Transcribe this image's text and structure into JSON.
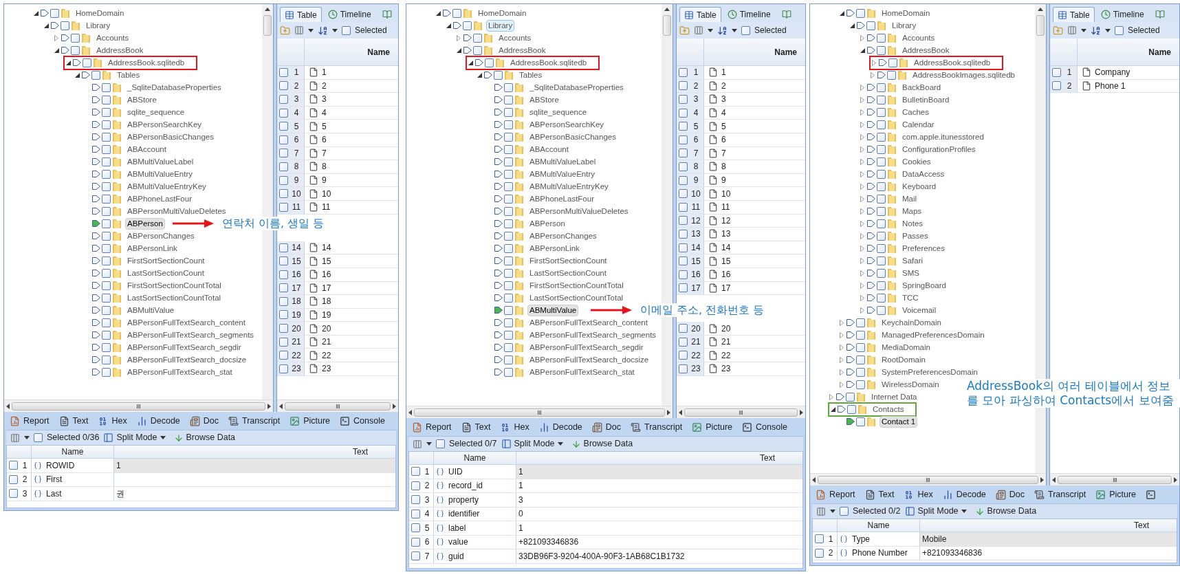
{
  "panels": [
    {
      "tree": {
        "inner": [
          {
            "label": "HomeDomain",
            "expanded": true,
            "selected": false,
            "checked": false,
            "children": [
              {
                "label": "Library",
                "expanded": true,
                "selected": false,
                "checked": false,
                "children": [
                  {
                    "label": "Accounts",
                    "expanded": false,
                    "selected": false,
                    "checked": false
                  },
                  {
                    "label": "AddressBook",
                    "expanded": true,
                    "selected": false,
                    "checked": false,
                    "children": [
                      {
                        "label": "AddressBook.sqlitedb",
                        "expanded": true,
                        "selected": false,
                        "checked": false,
                        "color": "#e8141b",
                        "children": [
                          {
                            "label": "Tables",
                            "expanded": true,
                            "selected": false,
                            "checked": false,
                            "children": [
                              {
                                "label": "_SqliteDatabaseProperties",
                                "selected": false,
                                "checked": false
                              },
                              {
                                "label": "ABStore",
                                "selected": false,
                                "checked": false
                              },
                              {
                                "label": "sqlite_sequence",
                                "selected": false,
                                "checked": false
                              },
                              {
                                "label": "ABPersonSearchKey",
                                "selected": false,
                                "checked": false
                              },
                              {
                                "label": "ABPersonBasicChanges",
                                "selected": false,
                                "checked": false
                              },
                              {
                                "label": "ABAccount",
                                "selected": false,
                                "checked": false
                              },
                              {
                                "label": "ABMultiValueLabel",
                                "selected": false,
                                "checked": false
                              },
                              {
                                "label": "ABMultiValueEntry",
                                "selected": false,
                                "checked": false
                              },
                              {
                                "label": "ABMultiValueEntryKey",
                                "selected": false,
                                "checked": false
                              },
                              {
                                "label": "ABPhoneLastFour",
                                "selected": false,
                                "checked": false
                              },
                              {
                                "label": "ABPersonMultiValueDeletes",
                                "selected": false,
                                "checked": false
                              },
                              {
                                "label": "ABPerson",
                                "selected": true,
                                "checked": false
                              },
                              {
                                "label": "ABPersonChanges",
                                "selected": false,
                                "checked": false
                              },
                              {
                                "label": "ABPersonLink",
                                "selected": false,
                                "checked": false
                              },
                              {
                                "label": "FirstSortSectionCount",
                                "selected": false,
                                "checked": false
                              },
                              {
                                "label": "LastSortSectionCount",
                                "selected": false,
                                "checked": false
                              },
                              {
                                "label": "FirstSortSectionCountTotal",
                                "selected": false,
                                "checked": false
                              },
                              {
                                "label": "LastSortSectionCountTotal",
                                "selected": false,
                                "checked": false
                              },
                              {
                                "label": "ABMultiValue",
                                "selected": false,
                                "checked": false
                              },
                              {
                                "label": "ABPersonFullTextSearch_content",
                                "selected": false,
                                "checked": false
                              },
                              {
                                "label": "ABPersonFullTextSearch_segments",
                                "selected": false,
                                "checked": false
                              },
                              {
                                "label": "ABPersonFullTextSearch_segdir",
                                "selected": false,
                                "checked": false
                              },
                              {
                                "label": "ABPersonFullTextSearch_docsize",
                                "selected": false,
                                "checked": false
                              },
                              {
                                "label": "ABPersonFullTextSearch_stat",
                                "selected": false,
                                "checked": false
                              }
                            ]
                          }
                        ]
                      }
                    ]
                  }
                ]
              }
            ]
          }
        ]
      },
      "callout": {
        "text": "연락처 이름, 생일 등",
        "arrow": true
      },
      "table_pane": {
        "tabs": [
          {
            "kind": "table",
            "label": "Table",
            "selected": true
          },
          {
            "kind": "timeline",
            "label": "Timeline",
            "selected": false
          },
          {
            "kind": "book",
            "selected": false
          }
        ],
        "selected_label": "Selected",
        "checked": false,
        "columns": [
          "Name"
        ],
        "rows": [
          {
            "kind": "row",
            "index": "1",
            "name": "1",
            "checked": false
          },
          {
            "kind": "row",
            "index": "2",
            "name": "2",
            "checked": false
          },
          {
            "kind": "row",
            "index": "3",
            "name": "3",
            "checked": false
          },
          {
            "kind": "row",
            "index": "4",
            "name": "4",
            "checked": false
          },
          {
            "kind": "row",
            "index": "5",
            "name": "5",
            "checked": false
          },
          {
            "kind": "row",
            "index": "6",
            "name": "6",
            "checked": false
          },
          {
            "kind": "row",
            "index": "7",
            "name": "7",
            "checked": false
          },
          {
            "kind": "row",
            "index": "8",
            "name": "8",
            "checked": false
          },
          {
            "kind": "row",
            "index": "9",
            "name": "9",
            "checked": false
          },
          {
            "kind": "row",
            "index": "10",
            "name": "10",
            "checked": false
          },
          {
            "kind": "row",
            "index": "11",
            "name": "11",
            "checked": false
          },
          {
            "kind": "covered"
          },
          {
            "kind": "covered"
          },
          {
            "kind": "row",
            "index": "14",
            "name": "14",
            "checked": false
          },
          {
            "kind": "row",
            "index": "15",
            "name": "15",
            "checked": false
          },
          {
            "kind": "row",
            "index": "16",
            "name": "16",
            "checked": false
          },
          {
            "kind": "row",
            "index": "17",
            "name": "17",
            "checked": false
          },
          {
            "kind": "row",
            "index": "18",
            "name": "18",
            "checked": false
          },
          {
            "kind": "row",
            "index": "19",
            "name": "19",
            "checked": false
          },
          {
            "kind": "row",
            "index": "20",
            "name": "20",
            "checked": false
          },
          {
            "kind": "row",
            "index": "21",
            "name": "21",
            "checked": false
          },
          {
            "kind": "row",
            "index": "22",
            "name": "22",
            "checked": false
          },
          {
            "kind": "row",
            "index": "23",
            "name": "23",
            "checked": false
          }
        ]
      },
      "view_tabs": [
        {
          "kind": "report",
          "label": "Report"
        },
        {
          "kind": "text",
          "label": "Text"
        },
        {
          "kind": "hex",
          "label": "Hex"
        },
        {
          "kind": "decode",
          "label": "Decode"
        },
        {
          "kind": "doc",
          "label": "Doc"
        },
        {
          "kind": "transcript",
          "label": "Transcript"
        },
        {
          "kind": "picture",
          "label": "Picture"
        },
        {
          "kind": "console",
          "label": "Console"
        }
      ],
      "toolbar": {
        "selected_label": "Selected 0/36",
        "checked": false,
        "split_label": "Split Mode",
        "browse_label": "Browse Data"
      },
      "grid": {
        "columns": [
          "Name",
          "Text"
        ],
        "rows": [
          {
            "index": "1",
            "name": "ROWID",
            "text": "1",
            "selected": true,
            "checked": false
          },
          {
            "index": "2",
            "name": "First",
            "selected": false,
            "checked": false
          },
          {
            "index": "3",
            "name": "Last",
            "text": "권",
            "selected": false,
            "checked": false
          }
        ]
      }
    },
    {
      "tree": {
        "inner": [
          {
            "label": "HomeDomain",
            "expanded": true,
            "selected": false,
            "checked": false,
            "children": [
              {
                "label": "Library",
                "expanded": true,
                "selected": false,
                "hovered": true,
                "checked": false,
                "children": [
                  {
                    "label": "Accounts",
                    "expanded": false,
                    "selected": false,
                    "checked": false
                  },
                  {
                    "label": "AddressBook",
                    "expanded": true,
                    "selected": false,
                    "checked": false,
                    "children": [
                      {
                        "label": "AddressBook.sqlitedb",
                        "expanded": true,
                        "selected": false,
                        "checked": false,
                        "color": "#e8141b",
                        "children": [
                          {
                            "label": "Tables",
                            "expanded": true,
                            "selected": false,
                            "checked": false,
                            "children": [
                              {
                                "label": "_SqliteDatabaseProperties",
                                "selected": false,
                                "checked": false
                              },
                              {
                                "label": "ABStore",
                                "selected": false,
                                "checked": false
                              },
                              {
                                "label": "sqlite_sequence",
                                "selected": false,
                                "checked": false
                              },
                              {
                                "label": "ABPersonSearchKey",
                                "selected": false,
                                "checked": false
                              },
                              {
                                "label": "ABPersonBasicChanges",
                                "selected": false,
                                "checked": false
                              },
                              {
                                "label": "ABAccount",
                                "selected": false,
                                "checked": false
                              },
                              {
                                "label": "ABMultiValueLabel",
                                "selected": false,
                                "checked": false
                              },
                              {
                                "label": "ABMultiValueEntry",
                                "selected": false,
                                "checked": false
                              },
                              {
                                "label": "ABMultiValueEntryKey",
                                "selected": false,
                                "checked": false
                              },
                              {
                                "label": "ABPhoneLastFour",
                                "selected": false,
                                "checked": false
                              },
                              {
                                "label": "ABPersonMultiValueDeletes",
                                "selected": false,
                                "checked": false
                              },
                              {
                                "label": "ABPerson",
                                "selected": false,
                                "checked": false
                              },
                              {
                                "label": "ABPersonChanges",
                                "selected": false,
                                "checked": false
                              },
                              {
                                "label": "ABPersonLink",
                                "selected": false,
                                "checked": false
                              },
                              {
                                "label": "FirstSortSectionCount",
                                "selected": false,
                                "checked": false
                              },
                              {
                                "label": "LastSortSectionCount",
                                "selected": false,
                                "checked": false
                              },
                              {
                                "label": "FirstSortSectionCountTotal",
                                "selected": false,
                                "checked": false
                              },
                              {
                                "label": "LastSortSectionCountTotal",
                                "selected": false,
                                "checked": false
                              },
                              {
                                "label": "ABMultiValue",
                                "selected": true,
                                "checked": false
                              },
                              {
                                "label": "ABPersonFullTextSearch_content",
                                "selected": false,
                                "checked": false
                              },
                              {
                                "label": "ABPersonFullTextSearch_segments",
                                "selected": false,
                                "checked": false
                              },
                              {
                                "label": "ABPersonFullTextSearch_segdir",
                                "selected": false,
                                "checked": false
                              },
                              {
                                "label": "ABPersonFullTextSearch_docsize",
                                "selected": false,
                                "checked": false
                              },
                              {
                                "label": "ABPersonFullTextSearch_stat",
                                "selected": false,
                                "checked": false
                              }
                            ]
                          }
                        ]
                      }
                    ]
                  }
                ]
              }
            ]
          }
        ]
      },
      "callout": {
        "text": "이메일 주소, 전화번호 등",
        "arrow": true
      },
      "table_pane": {
        "tabs": [
          {
            "kind": "table",
            "label": "Table",
            "selected": true
          },
          {
            "kind": "timeline",
            "label": "Timeline",
            "selected": false
          },
          {
            "kind": "book",
            "selected": false
          }
        ],
        "selected_label": "Selected",
        "checked": false,
        "columns": [
          "Name"
        ],
        "rows": [
          {
            "kind": "row",
            "index": "1",
            "name": "1",
            "checked": false
          },
          {
            "kind": "row",
            "index": "2",
            "name": "2",
            "checked": false
          },
          {
            "kind": "row",
            "index": "3",
            "name": "3",
            "checked": false
          },
          {
            "kind": "row",
            "index": "4",
            "name": "4",
            "checked": false
          },
          {
            "kind": "row",
            "index": "5",
            "name": "5",
            "checked": false
          },
          {
            "kind": "row",
            "index": "6",
            "name": "6",
            "checked": false
          },
          {
            "kind": "row",
            "index": "7",
            "name": "7",
            "checked": false
          },
          {
            "kind": "row",
            "index": "8",
            "name": "8",
            "checked": false
          },
          {
            "kind": "row",
            "index": "9",
            "name": "9",
            "checked": false
          },
          {
            "kind": "row",
            "index": "10",
            "name": "10",
            "checked": false
          },
          {
            "kind": "row",
            "index": "11",
            "name": "11",
            "checked": false
          },
          {
            "kind": "row",
            "index": "12",
            "name": "12",
            "checked": false
          },
          {
            "kind": "row",
            "index": "13",
            "name": "13",
            "checked": false
          },
          {
            "kind": "row",
            "index": "14",
            "name": "14",
            "checked": false
          },
          {
            "kind": "row",
            "index": "15",
            "name": "15",
            "checked": false
          },
          {
            "kind": "row",
            "index": "16",
            "name": "16",
            "checked": false
          },
          {
            "kind": "row",
            "index": "17",
            "name": "17",
            "checked": false
          },
          {
            "kind": "covered"
          },
          {
            "kind": "covered"
          },
          {
            "kind": "row",
            "index": "20",
            "name": "20",
            "checked": false
          },
          {
            "kind": "row",
            "index": "21",
            "name": "21",
            "checked": false
          },
          {
            "kind": "row",
            "index": "22",
            "name": "22",
            "checked": false
          },
          {
            "kind": "row",
            "index": "23",
            "name": "23",
            "checked": false
          }
        ]
      },
      "view_tabs": [
        {
          "kind": "report",
          "label": "Report"
        },
        {
          "kind": "text",
          "label": "Text"
        },
        {
          "kind": "hex",
          "label": "Hex"
        },
        {
          "kind": "decode",
          "label": "Decode"
        },
        {
          "kind": "doc",
          "label": "Doc"
        },
        {
          "kind": "transcript",
          "label": "Transcript"
        },
        {
          "kind": "picture",
          "label": "Picture"
        },
        {
          "kind": "console",
          "label": "Console"
        }
      ],
      "toolbar": {
        "selected_label": "Selected 0/7",
        "checked": false,
        "split_label": "Split Mode",
        "browse_label": "Browse Data"
      },
      "grid": {
        "columns": [
          "Name",
          "Text"
        ],
        "rows": [
          {
            "index": "1",
            "name": "UID",
            "text": "1",
            "selected": true,
            "checked": false
          },
          {
            "index": "2",
            "name": "record_id",
            "text": "1",
            "selected": false,
            "checked": false
          },
          {
            "index": "3",
            "name": "property",
            "text": "3",
            "selected": false,
            "checked": false
          },
          {
            "index": "4",
            "name": "identifier",
            "text": "0",
            "selected": false,
            "checked": false
          },
          {
            "index": "5",
            "name": "label",
            "text": "1",
            "selected": false,
            "checked": false
          },
          {
            "index": "6",
            "name": "value",
            "text": "+821093346836",
            "selected": false,
            "checked": false
          },
          {
            "index": "7",
            "name": "guid",
            "text": "33DB96F3-9204-400A-90F3-1AB68C1B1732",
            "selected": false,
            "checked": false
          }
        ]
      }
    },
    {
      "tree": {
        "inner": [
          {
            "label": "HomeDomain",
            "expanded": true,
            "selected": false,
            "checked": false,
            "children": [
              {
                "label": "Library",
                "expanded": true,
                "selected": false,
                "checked": false,
                "children": [
                  {
                    "label": "Accounts",
                    "expanded": false,
                    "selected": false,
                    "checked": false
                  },
                  {
                    "label": "AddressBook",
                    "expanded": true,
                    "selected": false,
                    "checked": false,
                    "children": [
                      {
                        "label": "AddressBook.sqlitedb",
                        "expanded": false,
                        "selected": false,
                        "checked": false,
                        "color": "#e8141b"
                      },
                      {
                        "label": "AddressBookImages.sqlitedb",
                        "expanded": false,
                        "selected": false,
                        "checked": false
                      }
                    ]
                  },
                  {
                    "label": "BackBoard",
                    "expanded": false,
                    "selected": false,
                    "checked": false
                  },
                  {
                    "label": "BulletinBoard",
                    "expanded": false,
                    "selected": false,
                    "checked": false
                  },
                  {
                    "label": "Caches",
                    "expanded": false,
                    "selected": false,
                    "checked": false
                  },
                  {
                    "label": "Calendar",
                    "expanded": false,
                    "selected": false,
                    "checked": false
                  },
                  {
                    "label": "com.apple.itunesstored",
                    "expanded": false,
                    "selected": false,
                    "checked": false
                  },
                  {
                    "label": "ConfigurationProfiles",
                    "expanded": false,
                    "selected": false,
                    "checked": false
                  },
                  {
                    "label": "Cookies",
                    "expanded": false,
                    "selected": false,
                    "checked": false
                  },
                  {
                    "label": "DataAccess",
                    "expanded": false,
                    "selected": false,
                    "checked": false
                  },
                  {
                    "label": "Keyboard",
                    "expanded": false,
                    "selected": false,
                    "checked": false
                  },
                  {
                    "label": "Mail",
                    "expanded": false,
                    "selected": false,
                    "checked": false
                  },
                  {
                    "label": "Maps",
                    "expanded": false,
                    "selected": false,
                    "checked": false
                  },
                  {
                    "label": "Notes",
                    "expanded": false,
                    "selected": false,
                    "checked": false
                  },
                  {
                    "label": "Passes",
                    "expanded": false,
                    "selected": false,
                    "checked": false
                  },
                  {
                    "label": "Preferences",
                    "expanded": false,
                    "selected": false,
                    "checked": false
                  },
                  {
                    "label": "Safari",
                    "expanded": false,
                    "selected": false,
                    "checked": false
                  },
                  {
                    "label": "SMS",
                    "expanded": false,
                    "selected": false,
                    "checked": false
                  },
                  {
                    "label": "SpringBoard",
                    "expanded": false,
                    "selected": false,
                    "checked": false
                  },
                  {
                    "label": "TCC",
                    "expanded": false,
                    "selected": false,
                    "checked": false
                  },
                  {
                    "label": "Voicemail",
                    "expanded": false,
                    "selected": false,
                    "checked": false
                  }
                ]
              }
            ]
          },
          {
            "label": "KeychainDomain",
            "expanded": false,
            "selected": false,
            "checked": false
          },
          {
            "label": "ManagedPreferencesDomain",
            "expanded": false,
            "selected": false,
            "checked": false
          },
          {
            "label": "MediaDomain",
            "expanded": false,
            "selected": false,
            "checked": false
          },
          {
            "label": "RootDomain",
            "expanded": false,
            "selected": false,
            "checked": false
          },
          {
            "label": "SystemPreferencesDomain",
            "expanded": false,
            "selected": false,
            "checked": false
          },
          {
            "label": "WirelessDomain",
            "expanded": false,
            "selected": false,
            "checked": false
          }
        ],
        "outer": [
          {
            "label": "Internet Data",
            "expanded": false,
            "selected": false,
            "checked": false
          },
          {
            "label": "Contacts",
            "expanded": true,
            "selected": false,
            "checked": false,
            "color": "#5fa83a",
            "children": [
              {
                "label": "Contact 1",
                "selected": true,
                "checked": false
              }
            ]
          }
        ]
      },
      "callout": {
        "text": "AddressBook의 여러 테이블에서 정보를 모아 파싱하여 Contacts에서 보여줌",
        "arrow": false
      },
      "table_pane": {
        "tabs": [
          {
            "kind": "table",
            "label": "Table",
            "selected": true
          },
          {
            "kind": "timeline",
            "label": "Timeline",
            "selected": false
          },
          {
            "kind": "book",
            "selected": false
          }
        ],
        "selected_label": "Selected",
        "checked": false,
        "columns": [
          "Name"
        ],
        "rows": [
          {
            "kind": "row",
            "index": "1",
            "name": "Company",
            "checked": false
          },
          {
            "kind": "row",
            "index": "2",
            "name": "Phone 1",
            "checked": false
          }
        ]
      },
      "view_tabs": [
        {
          "kind": "report",
          "label": "Report"
        },
        {
          "kind": "text",
          "label": "Text"
        },
        {
          "kind": "hex",
          "label": "Hex"
        },
        {
          "kind": "decode",
          "label": "Decode"
        },
        {
          "kind": "doc",
          "label": "Doc"
        },
        {
          "kind": "transcript",
          "label": "Transcript"
        },
        {
          "kind": "picture",
          "label": "Picture"
        },
        {
          "kind": "console"
        }
      ],
      "toolbar": {
        "selected_label": "Selected 0/2",
        "checked": false,
        "split_label": "Split Mode",
        "browse_label": "Browse Data"
      },
      "grid": {
        "columns": [
          "Name",
          "Text"
        ],
        "rows": [
          {
            "index": "1",
            "name": "Type",
            "text": "Mobile",
            "selected": true,
            "checked": false
          },
          {
            "index": "2",
            "name": "Phone Number",
            "text": "+821093346836",
            "selected": false,
            "checked": false
          }
        ]
      }
    }
  ]
}
